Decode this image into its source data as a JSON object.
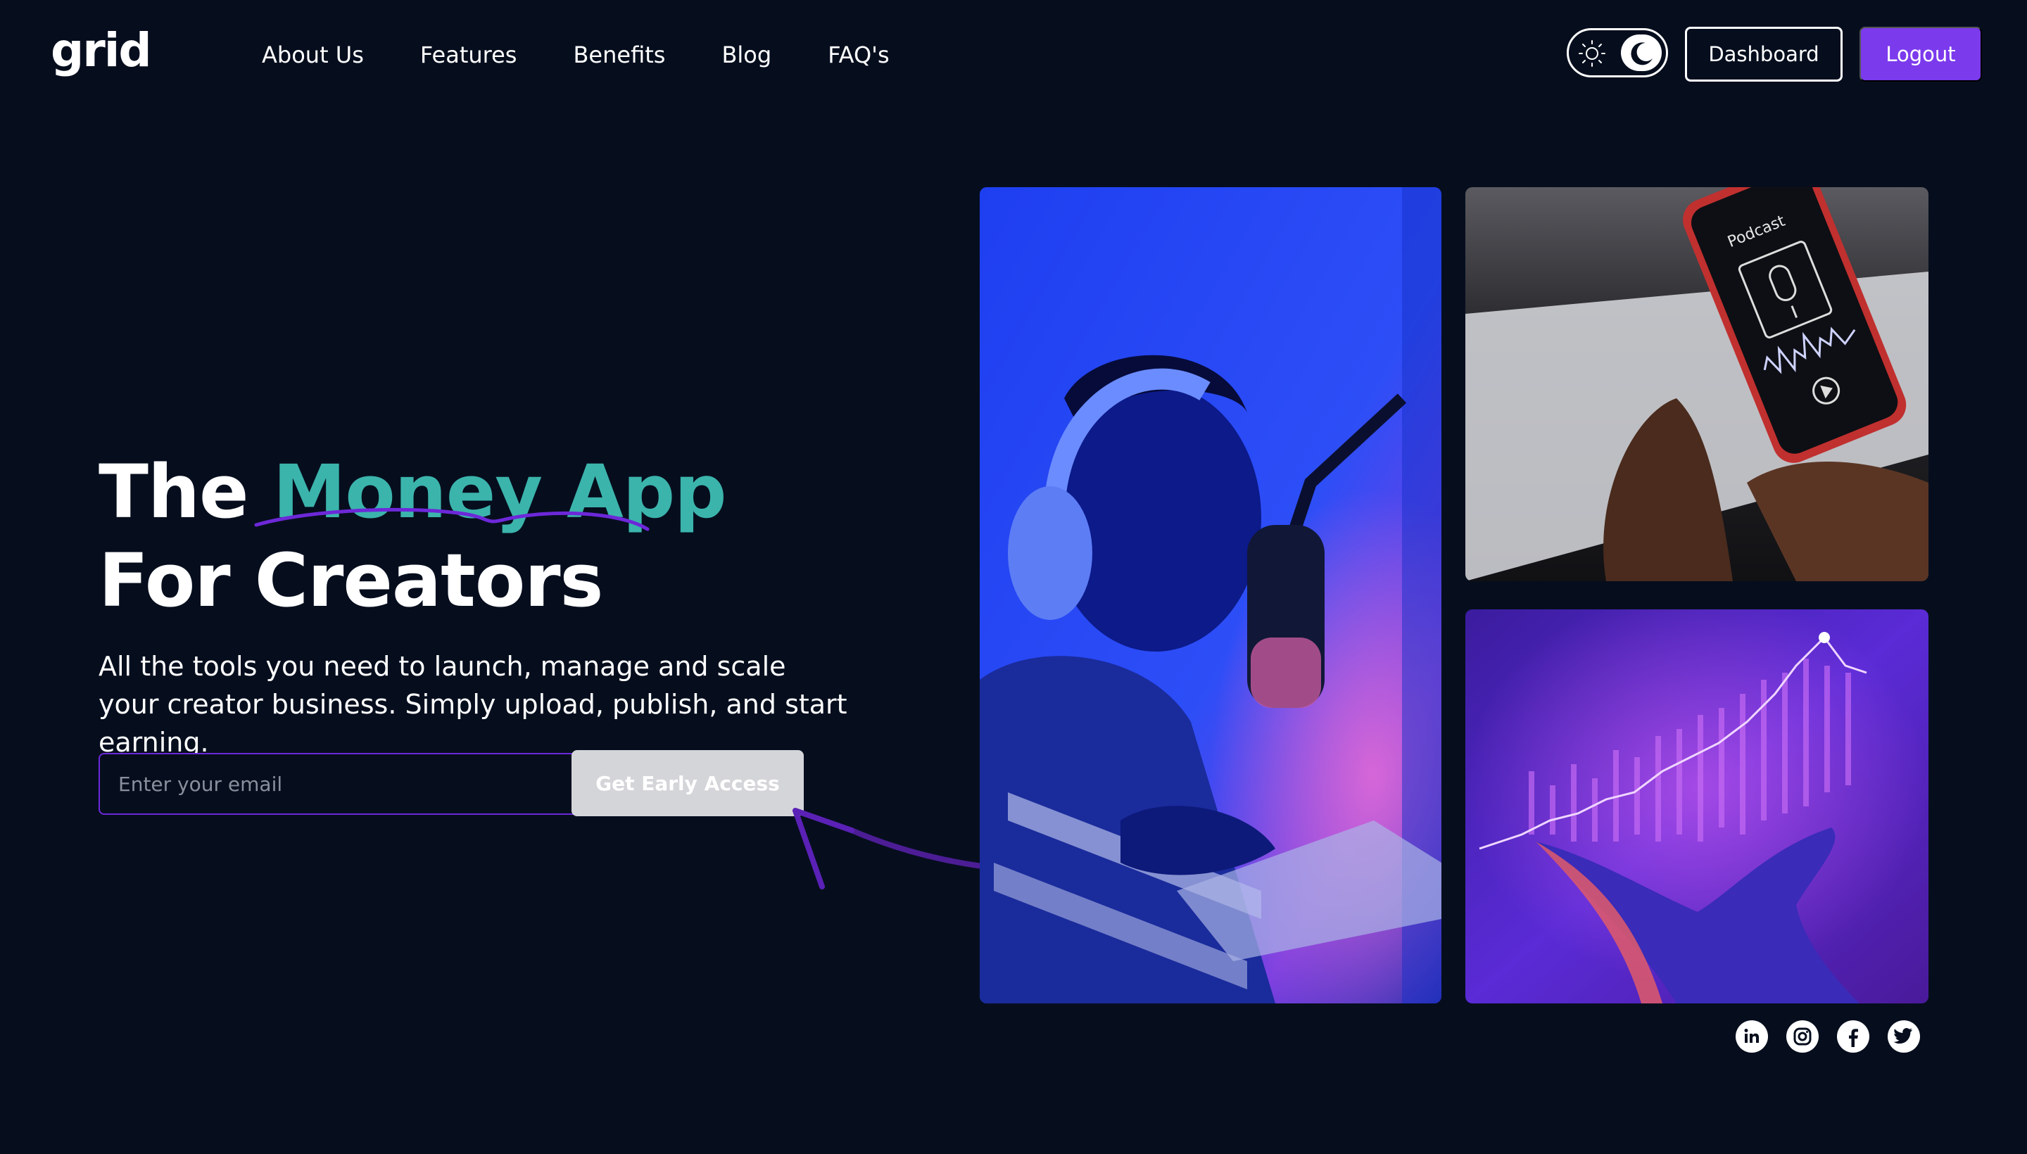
{
  "header": {
    "logo": "grid",
    "nav": [
      "About Us",
      "Features",
      "Benefits",
      "Blog",
      "FAQ's"
    ],
    "dashboard_label": "Dashboard",
    "logout_label": "Logout",
    "theme_toggle": {
      "icons": [
        "sun-icon",
        "moon-icon"
      ],
      "active": "dark"
    }
  },
  "hero": {
    "title_part1": "The ",
    "title_accent": "Money App",
    "title_line2": "For Creators",
    "subtitle_line1": "All the tools you need to launch, manage and scale",
    "subtitle_line2": "your creator business. Simply upload, publish, and start earning.",
    "email_placeholder": "Enter your email",
    "cta_label": "Get Early Access"
  },
  "images": {
    "phone_text": "Podcast"
  },
  "socials": [
    "linkedin-icon",
    "instagram-icon",
    "facebook-icon",
    "twitter-icon"
  ],
  "colors": {
    "background": "#060e1e",
    "accent_teal": "#3bb4ac",
    "accent_purple": "#7c3aed"
  }
}
